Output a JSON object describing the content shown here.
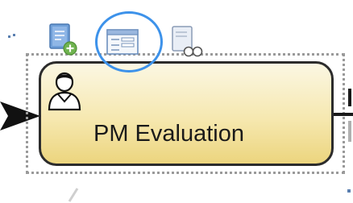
{
  "task": {
    "label": "PM Evaluation",
    "type_icon": "user-task-icon"
  },
  "context_toolbar": {
    "items": [
      {
        "icon": "add-document-icon"
      },
      {
        "icon": "form-icon",
        "highlighted": true
      },
      {
        "icon": "preview-icon"
      }
    ]
  },
  "colors": {
    "task_fill_top": "#fbf7e3",
    "task_fill_bottom": "#ecd57e",
    "task_border": "#2c2c2c",
    "highlight": "#3d92ea",
    "selection": "#9a9a9a",
    "icon_blue": "#5b8fd0",
    "icon_green": "#6fb34f"
  }
}
